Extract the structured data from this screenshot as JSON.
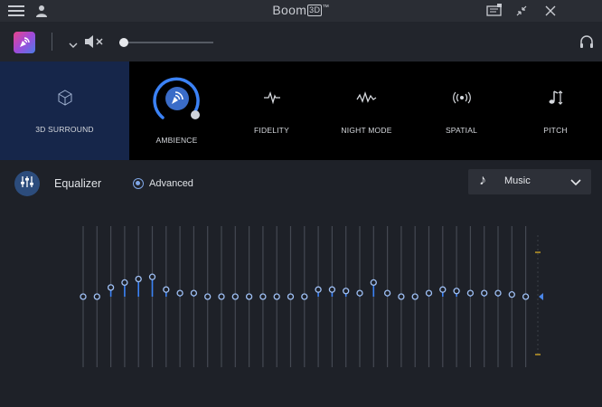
{
  "window": {
    "title": "Boom",
    "title_badge": "3D",
    "title_tm": "™"
  },
  "titlebar_icons": [
    "menu-icon",
    "user-icon",
    "feedback-icon",
    "compact-mode-icon",
    "close-icon"
  ],
  "toolbar": {
    "volume_level": 0.05,
    "icons": [
      "boom-logo-icon",
      "chevron-down-icon",
      "speaker-muted-icon",
      "headphones-icon"
    ]
  },
  "effects": [
    {
      "id": "3d-surround",
      "label": "3D SURROUND",
      "icon": "cube-icon",
      "active": true
    },
    {
      "id": "ambience",
      "label": "AMBIENCE",
      "icon": "ambience-icon",
      "active": false,
      "dial": true
    },
    {
      "id": "fidelity",
      "label": "FIDELITY",
      "icon": "fidelity-icon",
      "active": false
    },
    {
      "id": "night-mode",
      "label": "NIGHT MODE",
      "icon": "night-mode-icon",
      "active": false
    },
    {
      "id": "spatial",
      "label": "SPATIAL",
      "icon": "spatial-icon",
      "active": false
    },
    {
      "id": "pitch",
      "label": "PITCH",
      "icon": "pitch-icon",
      "active": false
    }
  ],
  "equalizer": {
    "title": "Equalizer",
    "advanced_label": "Advanced",
    "advanced_checked": true,
    "preset": "Music",
    "accent": "#3b82f6",
    "band_levels": [
      0,
      0,
      0.13,
      0.2,
      0.25,
      0.28,
      0.1,
      0.05,
      0.05,
      0,
      0,
      0,
      0,
      0,
      0,
      0,
      0,
      0.1,
      0.1,
      0.08,
      0.05,
      0.2,
      0.05,
      0,
      0,
      0.05,
      0.1,
      0.08,
      0.05,
      0.05,
      0.05,
      0.03,
      0
    ]
  },
  "colors": {
    "bg": "#1e2128",
    "titlebar": "#2a2d34",
    "effects_bg": "#000000",
    "active_effect": "#16264a",
    "accent": "#4a86e8"
  }
}
